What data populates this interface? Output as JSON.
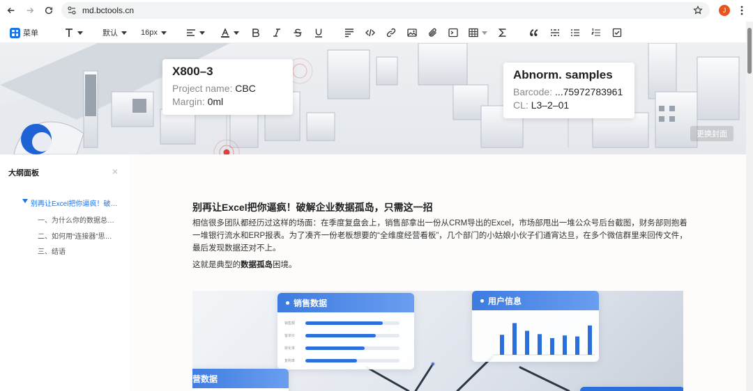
{
  "browser": {
    "url": "md.bctools.cn",
    "profile_initial": "J"
  },
  "toolbar": {
    "menu_label": "菜单",
    "font_family": "默认",
    "font_size": "16px"
  },
  "cover": {
    "callout_left": {
      "title": "X800–3",
      "line1_label": "Project name: ",
      "line1_value": "CBC",
      "line2_label": "Margin: ",
      "line2_value": "0ml"
    },
    "callout_right": {
      "title": "Abnorm. samples",
      "line1_label": "Barcode: ",
      "line1_value": "...75972783961",
      "line2_label": "CL: ",
      "line2_value": "L3–2–01"
    },
    "change_cover_label": "更换封面"
  },
  "outline": {
    "title": "大纲面板",
    "items": [
      {
        "label": "别再让Excel把你逼疯！破…"
      },
      {
        "label": "一、为什么你的数据总是…"
      },
      {
        "label": "二、如何用“连接器”思…"
      },
      {
        "label": "三、结语"
      }
    ]
  },
  "doc": {
    "title": "别再让Excel把你逼疯！破解企业数据孤岛，只需这一招",
    "para1": "相信很多团队都经历过这样的场面：在季度复盘会上，销售部拿出一份从CRM导出的Excel，市场部甩出一堆公众号后台截图，财务部则抱着一堆银行流水和ERP报表。为了凑齐一份老板想要的“全维度经营看板”，几个部门的小姑娘小伙子们通宵达旦，在多个微信群里来回传文件，最后发现数据还对不上。",
    "para2_pre": "这就是典型的",
    "para2_bold": "数据孤岛",
    "para2_post": "困境。"
  },
  "picture": {
    "sales_card_title": "销售数据",
    "user_card_title": "用户信息",
    "third_card_title": "营数据",
    "sales_rows": [
      {
        "label": "销售额",
        "fraction": 0.82
      },
      {
        "label": "客单价",
        "fraction": 0.75
      },
      {
        "label": "转化率",
        "fraction": 0.63
      },
      {
        "label": "复购率",
        "fraction": 0.55
      }
    ],
    "user_bars": [
      0.6,
      0.95,
      0.72,
      0.62,
      0.5,
      0.58,
      0.55,
      0.88
    ]
  },
  "colors": {
    "accent": "#1a73e8",
    "profile": "#e8541d"
  }
}
